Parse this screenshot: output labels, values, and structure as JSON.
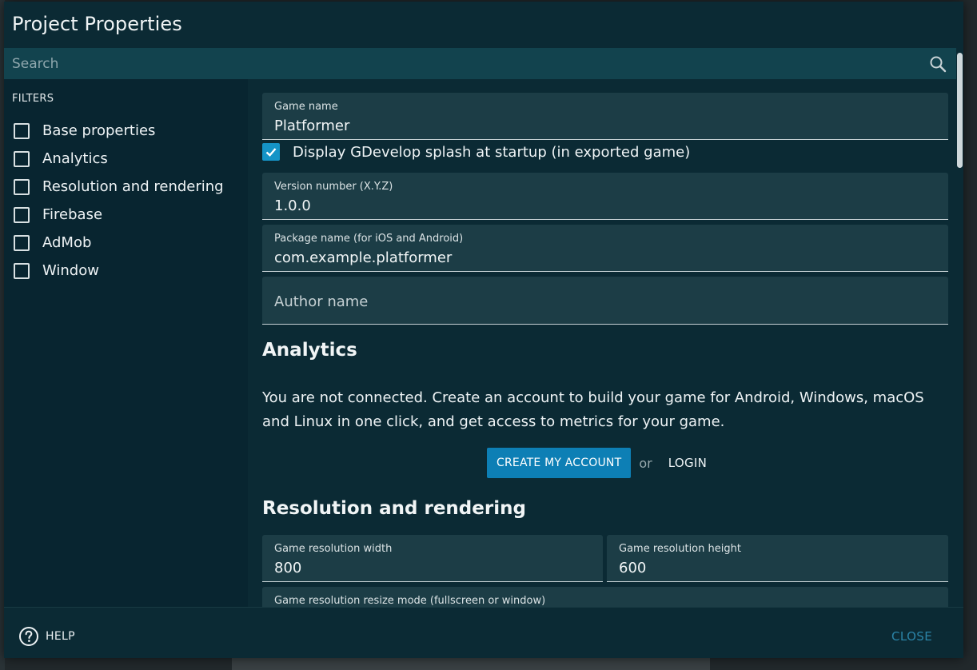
{
  "dialog": {
    "title": "Project Properties"
  },
  "search": {
    "placeholder": "Search",
    "icon": "search-icon"
  },
  "filters": {
    "label": "FILTERS",
    "items": [
      {
        "label": "Base properties",
        "checked": false
      },
      {
        "label": "Analytics",
        "checked": false
      },
      {
        "label": "Resolution and rendering",
        "checked": false
      },
      {
        "label": "Firebase",
        "checked": false
      },
      {
        "label": "AdMob",
        "checked": false
      },
      {
        "label": "Window",
        "checked": false
      }
    ]
  },
  "base": {
    "game_name_label": "Game name",
    "game_name_value": "Platformer",
    "splash_label": "Display GDevelop splash at startup (in exported game)",
    "splash_checked": true,
    "version_label": "Version number (X.Y.Z)",
    "version_value": "1.0.0",
    "package_label": "Package name (for iOS and Android)",
    "package_value": "com.example.platformer",
    "author_placeholder": "Author name"
  },
  "analytics": {
    "title": "Analytics",
    "message": "You are not connected. Create an account to build your game for Android, Windows, macOS and Linux in one click, and get access to metrics for your game.",
    "create_account_label": "CREATE MY ACCOUNT",
    "or_label": "or",
    "login_label": "LOGIN"
  },
  "resolution": {
    "title": "Resolution and rendering",
    "width_label": "Game resolution width",
    "width_value": "800",
    "height_label": "Game resolution height",
    "height_value": "600",
    "resize_mode_label": "Game resolution resize mode (fullscreen or window)"
  },
  "footer": {
    "help_label": "HELP",
    "close_label": "CLOSE"
  },
  "colors": {
    "dialog_bg": "#0b2a34",
    "field_bg": "#1c3d46",
    "accent": "#0d7fb5",
    "checkbox_checked": "#1594c7",
    "close_text": "#2b84a8"
  }
}
